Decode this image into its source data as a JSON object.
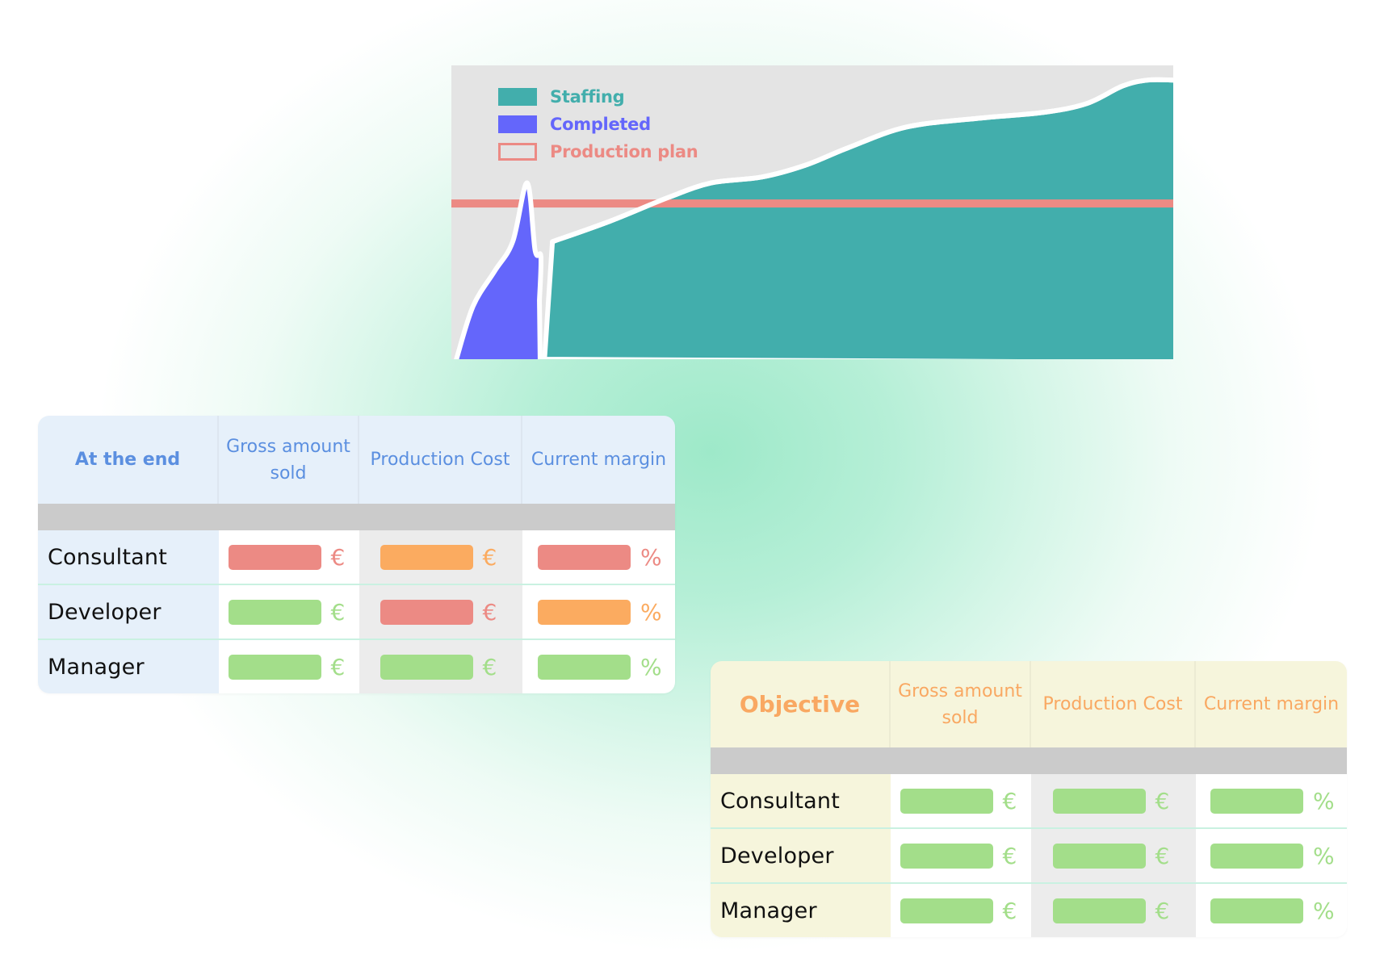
{
  "colors": {
    "staffing": "#42aeac",
    "completed": "#6466fb",
    "production_plan": "#ec8a84",
    "good": "#a3de8a",
    "warning": "#fbab60",
    "bad": "#ec8a84"
  },
  "chart_data": {
    "type": "area",
    "title": "",
    "xlabel": "",
    "ylabel": "",
    "xlim": [
      0,
      100
    ],
    "ylim": [
      0,
      100
    ],
    "grid": false,
    "legend_position": "top-left",
    "legend": [
      {
        "label": "Staffing",
        "style": "filled",
        "color": "#42aeac"
      },
      {
        "label": "Completed",
        "style": "filled",
        "color": "#6466fb"
      },
      {
        "label": "Production plan",
        "style": "outline",
        "color": "#ec8a84"
      }
    ],
    "series": [
      {
        "name": "Completed",
        "x": [
          0.7,
          3,
          6,
          8.5,
          10.5,
          11.6,
          12.4,
          12.2,
          12.3,
          13.9
        ],
        "values": [
          0,
          18,
          30,
          40,
          60,
          37,
          35,
          20,
          0,
          0
        ]
      },
      {
        "name": "Staffing",
        "x": [
          12.9,
          14,
          22,
          30,
          36,
          43,
          49,
          55,
          63,
          73,
          82,
          88,
          93,
          96.5,
          100
        ],
        "values": [
          0,
          40,
          47,
          55,
          60,
          62,
          66,
          72,
          79,
          82,
          84,
          87,
          93,
          95,
          95
        ]
      },
      {
        "name": "Production plan",
        "type": "hline",
        "value": 53
      }
    ]
  },
  "tables": [
    {
      "title": "At the end",
      "columns": [
        "Gross amount sold",
        "Production Cost",
        "Current margin"
      ],
      "units": [
        "€",
        "€",
        "%"
      ],
      "rows": [
        {
          "label": "Consultant",
          "status": [
            "bad",
            "warning",
            "bad"
          ]
        },
        {
          "label": "Developer",
          "status": [
            "good",
            "bad",
            "warning"
          ]
        },
        {
          "label": "Manager",
          "status": [
            "good",
            "good",
            "good"
          ]
        }
      ]
    },
    {
      "title": "Objective",
      "columns": [
        "Gross amount sold",
        "Production Cost",
        "Current margin"
      ],
      "units": [
        "€",
        "€",
        "%"
      ],
      "rows": [
        {
          "label": "Consultant",
          "status": [
            "good",
            "good",
            "good"
          ]
        },
        {
          "label": "Developer",
          "status": [
            "good",
            "good",
            "good"
          ]
        },
        {
          "label": "Manager",
          "status": [
            "good",
            "good",
            "good"
          ]
        }
      ]
    }
  ]
}
